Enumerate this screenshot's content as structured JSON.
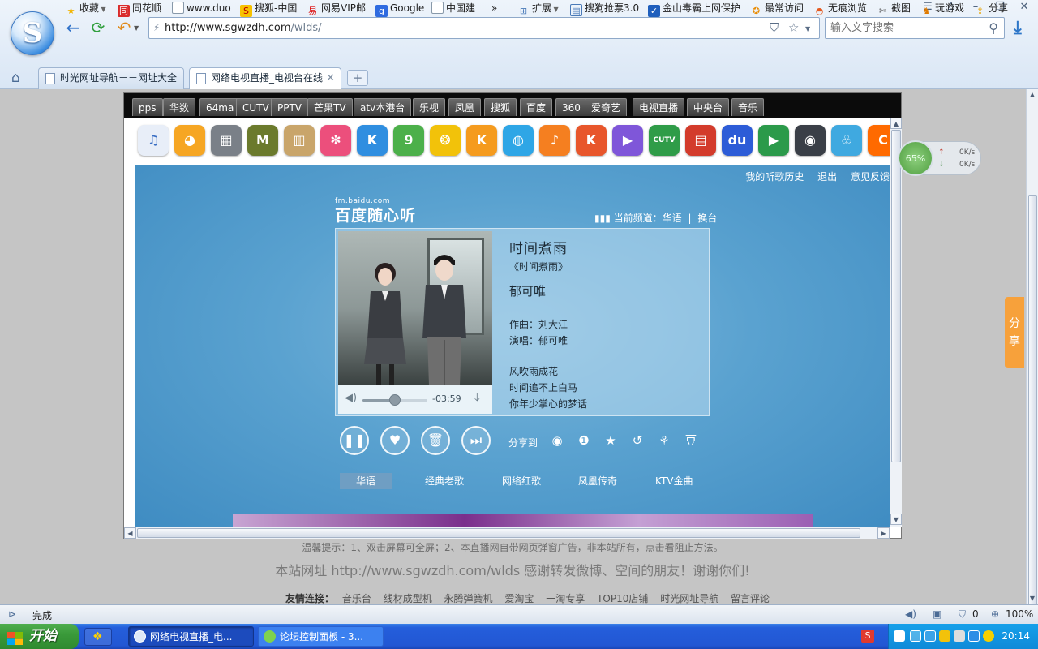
{
  "browser": {
    "url_host": "http://www.sgwzdh.com",
    "url_path": "/wlds/",
    "search_placeholder": "输入文字搜索",
    "logo_letter": "S",
    "bookmarks": [
      "收藏",
      "同花顺",
      "www.duo",
      "搜狐-中国",
      "网易VIP邮",
      "Google",
      "中国建",
      "»",
      "扩展",
      "搜狗抢票3.0",
      "金山毒霸上网保护",
      "最常访问",
      "无痕浏览",
      "截图",
      "玩游戏",
      "分享"
    ],
    "tabs": [
      {
        "title": "时光网址导航－－网址大全"
      },
      {
        "title": "网络电视直播_电视台在线"
      }
    ]
  },
  "categories": [
    "pps",
    "华数",
    "64ma",
    "CUTV",
    "PPTV",
    "芒果TV",
    "atv本港台",
    "乐视",
    "凤凰",
    "搜狐",
    "百度",
    "360",
    "爱奇艺",
    "电视直播",
    "中央台",
    "音乐"
  ],
  "app_icons": [
    {
      "name": "music-note-icon",
      "glyph": "♫",
      "color": "#e8eef8"
    },
    {
      "name": "kuwo-icon",
      "glyph": "◕",
      "color": "#f6a623"
    },
    {
      "name": "radio-icon",
      "glyph": "▦",
      "color": "#7a8088"
    },
    {
      "name": "m-icon",
      "glyph": "M",
      "color": "#6b7a2c"
    },
    {
      "name": "speaker-icon",
      "glyph": "▥",
      "color": "#c9a56a"
    },
    {
      "name": "flower-icon",
      "glyph": "✻",
      "color": "#ec4f7c"
    },
    {
      "name": "k-icon",
      "glyph": "K",
      "color": "#2f8ee0"
    },
    {
      "name": "nine-icon",
      "glyph": "9",
      "color": "#4cb04a"
    },
    {
      "name": "swirl-icon",
      "glyph": "❂",
      "color": "#f2c20a"
    },
    {
      "name": "kugou-box-icon",
      "glyph": "K",
      "color": "#f59b1e"
    },
    {
      "name": "dolphin-icon",
      "glyph": "◍",
      "color": "#2ea6e6"
    },
    {
      "name": "music-box-icon",
      "glyph": "♪",
      "color": "#f57f20"
    },
    {
      "name": "karaoke-icon",
      "glyph": "K",
      "color": "#e8562b"
    },
    {
      "name": "play-triangle-icon",
      "glyph": "▶",
      "color": "#7f56d9"
    },
    {
      "name": "cutv-icon",
      "glyph": "CUTV",
      "color": "#2f9c48"
    },
    {
      "name": "tv-icon",
      "glyph": "▤",
      "color": "#d33b2b"
    },
    {
      "name": "baidu-icon",
      "glyph": "du",
      "color": "#2d5cd7"
    },
    {
      "name": "player-icon",
      "glyph": "▶",
      "color": "#2b9a4a"
    },
    {
      "name": "camera-icon",
      "glyph": "◉",
      "color": "#3a3f47"
    },
    {
      "name": "bird-icon",
      "glyph": "♧",
      "color": "#3fa9e0"
    },
    {
      "name": "c-icon",
      "glyph": "C",
      "color": "#ff6a00"
    }
  ],
  "player": {
    "top_links": [
      "我的听歌历史",
      "退出",
      "意见反馈"
    ],
    "brand_small": "fm.baidu.com",
    "brand_big": "百度随心听",
    "current_channel_label": "当前频道：",
    "current_channel": "华语",
    "switch_channel": "换台",
    "song_title": "时间煮雨",
    "album": "《时间煮雨》",
    "artist": "郁可唯",
    "composer": "作曲：刘大江",
    "singer": "演唱：郁可唯",
    "lyrics": [
      "风吹雨成花",
      "时间追不上白马",
      "你年少掌心的梦话"
    ],
    "time_remaining": "-03:59",
    "volume": 0.5,
    "share_label": "分享到",
    "channels": [
      "华语",
      "经典老歌",
      "网络红歌",
      "凤凰传奇",
      "KTV金曲"
    ]
  },
  "float_share": "分享",
  "speed_widget": {
    "percent": "65%",
    "up": "0K/s",
    "down": "0K/s"
  },
  "tip": {
    "text": "温馨提示：1、双击屏幕可全屏；2、本直播网自带网页弹窗广告，非本站所有，点击看",
    "link": "阻止方法。"
  },
  "site_line": "本站网址 http://www.sgwzdh.com/wlds 感谢转发微博、空间的朋友！谢谢你们!",
  "friends": {
    "label": "友情连接：",
    "links": [
      "音乐台",
      "线材成型机",
      "永腾弹簧机",
      "爱淘宝",
      "一淘专享",
      "TOP10店铺",
      "时光网址导航",
      "留言评论"
    ]
  },
  "statusbar": {
    "status": "完成",
    "counter": "0",
    "zoom": "100%"
  },
  "taskbar": {
    "start": "开始",
    "tasks": [
      "网络电视直播_电...",
      "论坛控制面板 - 3..."
    ],
    "clock": "20:14"
  }
}
